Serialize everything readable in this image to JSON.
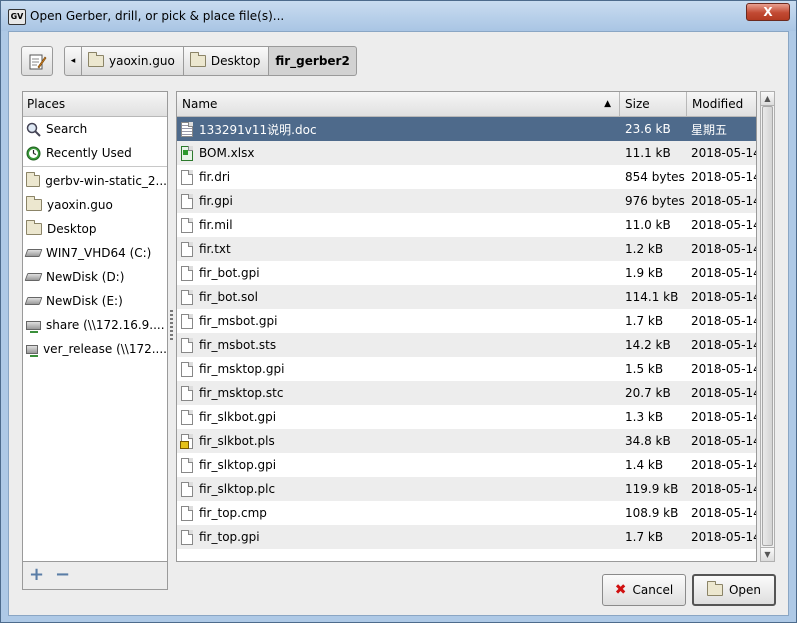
{
  "window": {
    "title": "Open Gerber, drill, or pick & place file(s)...",
    "close_label": "X",
    "app_icon_label": "GV"
  },
  "pathbar": {
    "back_arrow": "◂",
    "crumbs": [
      {
        "label": "yaoxin.guo"
      },
      {
        "label": "Desktop"
      },
      {
        "label": "fir_gerber2"
      }
    ]
  },
  "places": {
    "header": "Places",
    "items": [
      {
        "label": "Search",
        "icon": "search-icon"
      },
      {
        "label": "Recently Used",
        "icon": "recent-icon"
      },
      {
        "label": "gerbv-win-static_2...",
        "icon": "folder-icon"
      },
      {
        "label": "yaoxin.guo",
        "icon": "folder-icon"
      },
      {
        "label": "Desktop",
        "icon": "folder-icon"
      },
      {
        "label": "WIN7_VHD64 (C:)",
        "icon": "drive-icon"
      },
      {
        "label": "NewDisk (D:)",
        "icon": "drive-icon"
      },
      {
        "label": "NewDisk (E:)",
        "icon": "drive-icon"
      },
      {
        "label": "share (\\\\172.16.9....",
        "icon": "network-drive-icon"
      },
      {
        "label": "ver_release (\\\\172....",
        "icon": "network-drive-icon"
      }
    ],
    "add_label": "+",
    "remove_label": "−"
  },
  "filelist": {
    "columns": {
      "name": "Name",
      "size": "Size",
      "modified": "Modified"
    },
    "sort_arrow": "▲",
    "rows": [
      {
        "name": "133291v11说明.doc",
        "size": "23.6 kB",
        "modified": "星期五",
        "type": "doc",
        "selected": true
      },
      {
        "name": "BOM.xlsx",
        "size": "11.1 kB",
        "modified": "2018-05-14",
        "type": "xls"
      },
      {
        "name": "fir.dri",
        "size": "854 bytes",
        "modified": "2018-05-14",
        "type": "file"
      },
      {
        "name": "fir.gpi",
        "size": "976 bytes",
        "modified": "2018-05-14",
        "type": "file"
      },
      {
        "name": "fir.mil",
        "size": "11.0 kB",
        "modified": "2018-05-14",
        "type": "file"
      },
      {
        "name": "fir.txt",
        "size": "1.2 kB",
        "modified": "2018-05-14",
        "type": "file"
      },
      {
        "name": "fir_bot.gpi",
        "size": "1.9 kB",
        "modified": "2018-05-14",
        "type": "file"
      },
      {
        "name": "fir_bot.sol",
        "size": "114.1 kB",
        "modified": "2018-05-14",
        "type": "file"
      },
      {
        "name": "fir_msbot.gpi",
        "size": "1.7 kB",
        "modified": "2018-05-14",
        "type": "file"
      },
      {
        "name": "fir_msbot.sts",
        "size": "14.2 kB",
        "modified": "2018-05-14",
        "type": "file"
      },
      {
        "name": "fir_msktop.gpi",
        "size": "1.5 kB",
        "modified": "2018-05-14",
        "type": "file"
      },
      {
        "name": "fir_msktop.stc",
        "size": "20.7 kB",
        "modified": "2018-05-14",
        "type": "file"
      },
      {
        "name": "fir_slkbot.gpi",
        "size": "1.3 kB",
        "modified": "2018-05-14",
        "type": "file"
      },
      {
        "name": "fir_slkbot.pls",
        "size": "34.8 kB",
        "modified": "2018-05-14",
        "type": "pls"
      },
      {
        "name": "fir_slktop.gpi",
        "size": "1.4 kB",
        "modified": "2018-05-14",
        "type": "file"
      },
      {
        "name": "fir_slktop.plc",
        "size": "119.9 kB",
        "modified": "2018-05-14",
        "type": "file"
      },
      {
        "name": "fir_top.cmp",
        "size": "108.9 kB",
        "modified": "2018-05-14",
        "type": "file"
      },
      {
        "name": "fir_top.gpi",
        "size": "1.7 kB",
        "modified": "2018-05-14",
        "type": "file"
      }
    ]
  },
  "buttons": {
    "cancel": "Cancel",
    "open": "Open"
  },
  "colors": {
    "selection": "#4e6a8b",
    "titlebar": "#aec9e6",
    "close": "#c24a33"
  }
}
